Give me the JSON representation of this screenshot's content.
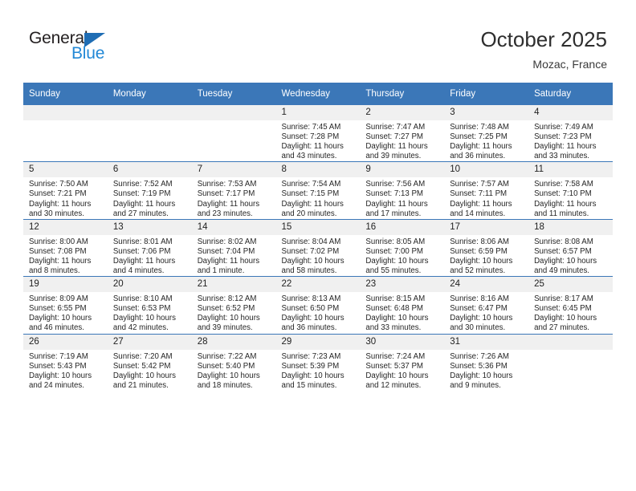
{
  "brand": {
    "word_general": "General",
    "word_blue": "Blue",
    "triangle_icon": "triangle-icon",
    "accent_blue": "#3b77b8",
    "logo_blue": "#2288d6",
    "logo_dark": "#231f20"
  },
  "header": {
    "title": "October 2025",
    "subtitle": "Mozac, France"
  },
  "weekdays": [
    "Sunday",
    "Monday",
    "Tuesday",
    "Wednesday",
    "Thursday",
    "Friday",
    "Saturday"
  ],
  "weeks": [
    [
      {
        "day": "",
        "blank": true
      },
      {
        "day": "",
        "blank": true
      },
      {
        "day": "",
        "blank": true
      },
      {
        "day": "1",
        "sunrise": "Sunrise: 7:45 AM",
        "sunset": "Sunset: 7:28 PM",
        "daylight": "Daylight: 11 hours and 43 minutes."
      },
      {
        "day": "2",
        "sunrise": "Sunrise: 7:47 AM",
        "sunset": "Sunset: 7:27 PM",
        "daylight": "Daylight: 11 hours and 39 minutes."
      },
      {
        "day": "3",
        "sunrise": "Sunrise: 7:48 AM",
        "sunset": "Sunset: 7:25 PM",
        "daylight": "Daylight: 11 hours and 36 minutes."
      },
      {
        "day": "4",
        "sunrise": "Sunrise: 7:49 AM",
        "sunset": "Sunset: 7:23 PM",
        "daylight": "Daylight: 11 hours and 33 minutes."
      }
    ],
    [
      {
        "day": "5",
        "sunrise": "Sunrise: 7:50 AM",
        "sunset": "Sunset: 7:21 PM",
        "daylight": "Daylight: 11 hours and 30 minutes."
      },
      {
        "day": "6",
        "sunrise": "Sunrise: 7:52 AM",
        "sunset": "Sunset: 7:19 PM",
        "daylight": "Daylight: 11 hours and 27 minutes."
      },
      {
        "day": "7",
        "sunrise": "Sunrise: 7:53 AM",
        "sunset": "Sunset: 7:17 PM",
        "daylight": "Daylight: 11 hours and 23 minutes."
      },
      {
        "day": "8",
        "sunrise": "Sunrise: 7:54 AM",
        "sunset": "Sunset: 7:15 PM",
        "daylight": "Daylight: 11 hours and 20 minutes."
      },
      {
        "day": "9",
        "sunrise": "Sunrise: 7:56 AM",
        "sunset": "Sunset: 7:13 PM",
        "daylight": "Daylight: 11 hours and 17 minutes."
      },
      {
        "day": "10",
        "sunrise": "Sunrise: 7:57 AM",
        "sunset": "Sunset: 7:11 PM",
        "daylight": "Daylight: 11 hours and 14 minutes."
      },
      {
        "day": "11",
        "sunrise": "Sunrise: 7:58 AM",
        "sunset": "Sunset: 7:10 PM",
        "daylight": "Daylight: 11 hours and 11 minutes."
      }
    ],
    [
      {
        "day": "12",
        "sunrise": "Sunrise: 8:00 AM",
        "sunset": "Sunset: 7:08 PM",
        "daylight": "Daylight: 11 hours and 8 minutes."
      },
      {
        "day": "13",
        "sunrise": "Sunrise: 8:01 AM",
        "sunset": "Sunset: 7:06 PM",
        "daylight": "Daylight: 11 hours and 4 minutes."
      },
      {
        "day": "14",
        "sunrise": "Sunrise: 8:02 AM",
        "sunset": "Sunset: 7:04 PM",
        "daylight": "Daylight: 11 hours and 1 minute."
      },
      {
        "day": "15",
        "sunrise": "Sunrise: 8:04 AM",
        "sunset": "Sunset: 7:02 PM",
        "daylight": "Daylight: 10 hours and 58 minutes."
      },
      {
        "day": "16",
        "sunrise": "Sunrise: 8:05 AM",
        "sunset": "Sunset: 7:00 PM",
        "daylight": "Daylight: 10 hours and 55 minutes."
      },
      {
        "day": "17",
        "sunrise": "Sunrise: 8:06 AM",
        "sunset": "Sunset: 6:59 PM",
        "daylight": "Daylight: 10 hours and 52 minutes."
      },
      {
        "day": "18",
        "sunrise": "Sunrise: 8:08 AM",
        "sunset": "Sunset: 6:57 PM",
        "daylight": "Daylight: 10 hours and 49 minutes."
      }
    ],
    [
      {
        "day": "19",
        "sunrise": "Sunrise: 8:09 AM",
        "sunset": "Sunset: 6:55 PM",
        "daylight": "Daylight: 10 hours and 46 minutes."
      },
      {
        "day": "20",
        "sunrise": "Sunrise: 8:10 AM",
        "sunset": "Sunset: 6:53 PM",
        "daylight": "Daylight: 10 hours and 42 minutes."
      },
      {
        "day": "21",
        "sunrise": "Sunrise: 8:12 AM",
        "sunset": "Sunset: 6:52 PM",
        "daylight": "Daylight: 10 hours and 39 minutes."
      },
      {
        "day": "22",
        "sunrise": "Sunrise: 8:13 AM",
        "sunset": "Sunset: 6:50 PM",
        "daylight": "Daylight: 10 hours and 36 minutes."
      },
      {
        "day": "23",
        "sunrise": "Sunrise: 8:15 AM",
        "sunset": "Sunset: 6:48 PM",
        "daylight": "Daylight: 10 hours and 33 minutes."
      },
      {
        "day": "24",
        "sunrise": "Sunrise: 8:16 AM",
        "sunset": "Sunset: 6:47 PM",
        "daylight": "Daylight: 10 hours and 30 minutes."
      },
      {
        "day": "25",
        "sunrise": "Sunrise: 8:17 AM",
        "sunset": "Sunset: 6:45 PM",
        "daylight": "Daylight: 10 hours and 27 minutes."
      }
    ],
    [
      {
        "day": "26",
        "sunrise": "Sunrise: 7:19 AM",
        "sunset": "Sunset: 5:43 PM",
        "daylight": "Daylight: 10 hours and 24 minutes."
      },
      {
        "day": "27",
        "sunrise": "Sunrise: 7:20 AM",
        "sunset": "Sunset: 5:42 PM",
        "daylight": "Daylight: 10 hours and 21 minutes."
      },
      {
        "day": "28",
        "sunrise": "Sunrise: 7:22 AM",
        "sunset": "Sunset: 5:40 PM",
        "daylight": "Daylight: 10 hours and 18 minutes."
      },
      {
        "day": "29",
        "sunrise": "Sunrise: 7:23 AM",
        "sunset": "Sunset: 5:39 PM",
        "daylight": "Daylight: 10 hours and 15 minutes."
      },
      {
        "day": "30",
        "sunrise": "Sunrise: 7:24 AM",
        "sunset": "Sunset: 5:37 PM",
        "daylight": "Daylight: 10 hours and 12 minutes."
      },
      {
        "day": "31",
        "sunrise": "Sunrise: 7:26 AM",
        "sunset": "Sunset: 5:36 PM",
        "daylight": "Daylight: 10 hours and 9 minutes."
      },
      {
        "day": "",
        "blank": true
      }
    ]
  ]
}
